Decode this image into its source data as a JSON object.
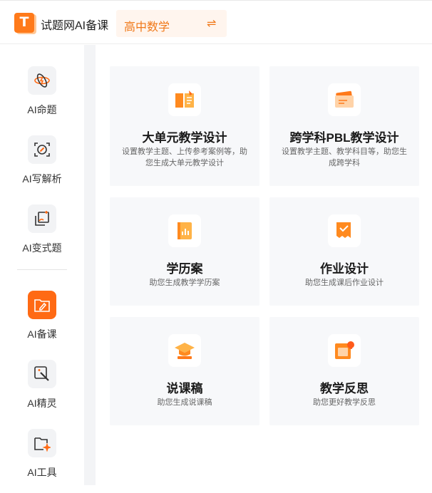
{
  "header": {
    "logo_letter": "T",
    "app_title": "试题网AI备课",
    "subject": "高中数学",
    "swap_icon": "⇌"
  },
  "sidebar": {
    "items": [
      {
        "label": "AI命题",
        "icon": "atom-icon"
      },
      {
        "label": "AI写解析",
        "icon": "scan-pen-icon"
      },
      {
        "label": "AI变式题",
        "icon": "copy-sparkle-icon"
      },
      {
        "label": "AI备课",
        "icon": "folder-pen-icon",
        "active": true
      },
      {
        "label": "AI精灵",
        "icon": "magic-wand-icon"
      },
      {
        "label": "AI工具",
        "icon": "folder-sparkle-icon"
      }
    ]
  },
  "cards": [
    {
      "title": "大单元教学设计",
      "desc": "设置教学主题、上传参考案例等，助您生成大单元教学设计",
      "icon": "book-pen-icon"
    },
    {
      "title": "跨学科PBL教学设计",
      "desc": "设置教学主题、教学科目等，助您生成跨学科",
      "icon": "cards-icon"
    },
    {
      "title": "学历案",
      "desc": "助您生成教学学历案",
      "icon": "chart-book-icon"
    },
    {
      "title": "作业设计",
      "desc": "助您生成课后作业设计",
      "icon": "scroll-check-icon"
    },
    {
      "title": "说课稿",
      "desc": "助您生成说课稿",
      "icon": "graduation-cap-icon"
    },
    {
      "title": "教学反思",
      "desc": "助您更好教学反思",
      "icon": "notebook-bulb-icon"
    }
  ],
  "colors": {
    "accent": "#ff6a14",
    "accent_light": "#fff5ee",
    "card_bg": "#f7f8fa"
  }
}
